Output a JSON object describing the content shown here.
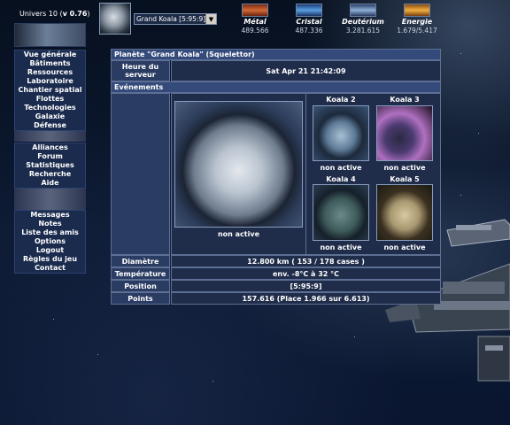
{
  "universe": {
    "prefix": "Univers 10 (",
    "version": "v 0.76",
    "suffix": ")"
  },
  "planet_selector": {
    "selected": "Grand Koala [5:95:9]"
  },
  "resources": [
    {
      "name": "Métal",
      "value": "489.566",
      "icon": "metal-icon",
      "color": "#c05a2e"
    },
    {
      "name": "Cristal",
      "value": "487.336",
      "icon": "crystal-icon",
      "color": "#3a78b8"
    },
    {
      "name": "Deutérium",
      "value": "3.281.615",
      "icon": "deuterium-icon",
      "color": "#4a6aa0"
    },
    {
      "name": "Energie",
      "value": "1.679/5.417",
      "icon": "energy-icon",
      "color": "#d08a2a"
    }
  ],
  "menu": {
    "group1": [
      "Vue générale",
      "Bâtiments",
      "Ressources",
      "Laboratoire",
      "Chantier spatial",
      "Flottes",
      "Technologies",
      "Galaxie",
      "Défense"
    ],
    "group2": [
      "Alliances",
      "Forum",
      "Statistiques",
      "Recherche",
      "Aide"
    ],
    "group3": [
      "Messages",
      "Notes",
      "Liste des amis",
      "Options",
      "Logout",
      "Règles du jeu",
      "Contact"
    ]
  },
  "overview": {
    "title": "Planète \"Grand Koala\" (Squelettor)",
    "server_time_label": "Heure du serveur",
    "server_time": "Sat Apr 21 21:42:09",
    "events_label": "Evénements",
    "main_planet_status": "non active",
    "moons": [
      {
        "name": "Koala 2",
        "status": "non active"
      },
      {
        "name": "Koala 3",
        "status": "non active"
      },
      {
        "name": "Koala 4",
        "status": "non active"
      },
      {
        "name": "Koala 5",
        "status": "non active"
      }
    ],
    "stats": [
      {
        "label": "Diamètre",
        "value": "12.800 km ( 153 / 178 cases )"
      },
      {
        "label": "Température",
        "value": "env. -8°C à 32 °C"
      },
      {
        "label": "Position",
        "value": "[5:95:9]"
      },
      {
        "label": "Points",
        "value": "157.616 (Place 1.966 sur 6.613)"
      }
    ]
  }
}
